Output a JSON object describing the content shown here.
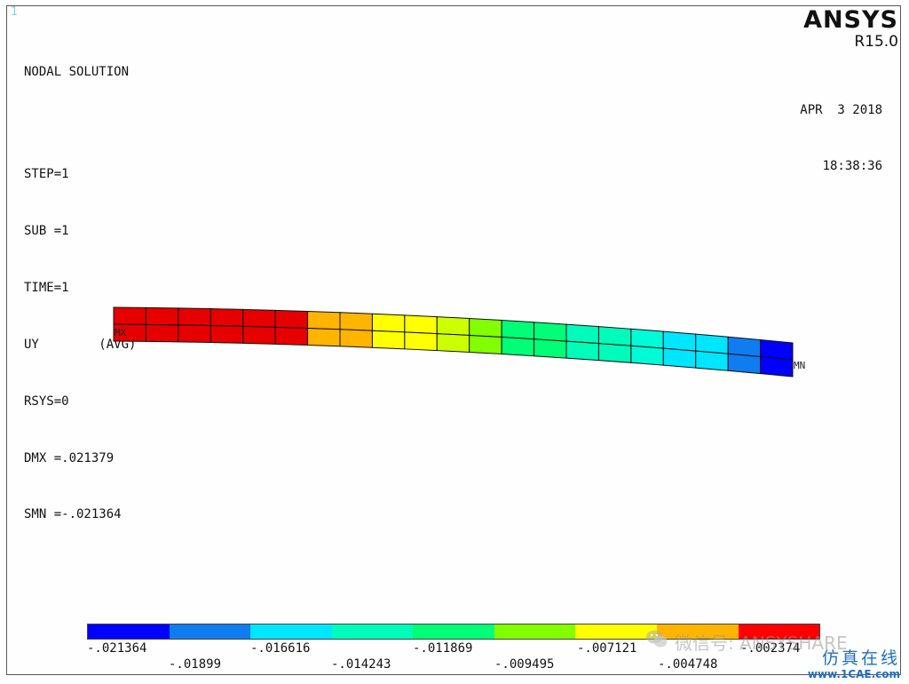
{
  "window_number": "1",
  "info": {
    "title": "NODAL SOLUTION",
    "step": "STEP=1",
    "sub": "SUB =1",
    "time": "TIME=1",
    "item": "UY        (AVG)",
    "rsys": "RSYS=0",
    "dmx": "DMX =.021379",
    "smn": "SMN =-.021364"
  },
  "brand": {
    "name": "ANSYS",
    "version": "R15.0"
  },
  "timestamp": {
    "date": "APR  3 2018",
    "time": "18:38:36"
  },
  "markers": {
    "max": "MX",
    "min": "MN"
  },
  "legend": {
    "colors": [
      "#0000ff",
      "#0f7cf0",
      "#00e6ff",
      "#00fcba",
      "#00ff77",
      "#82ff00",
      "#ffff00",
      "#ffb400",
      "#ff0000"
    ],
    "top_labels": [
      "-.021364",
      "-.016616",
      "-.011869",
      "-.007121",
      "-.002374"
    ],
    "bottom_labels": [
      "-.01899",
      "-.014243",
      "-.009495",
      "-.004748"
    ]
  },
  "contour_colors": [
    "#e60000",
    "#e60000",
    "#e60000",
    "#e60000",
    "#e60000",
    "#e60000",
    "#ffb400",
    "#ffb400",
    "#ffff00",
    "#ffff00",
    "#ccff00",
    "#82ff00",
    "#00ff77",
    "#00ff77",
    "#00fcba",
    "#00fcba",
    "#00fcd6",
    "#00e6ff",
    "#00e6ff",
    "#0f7cf0",
    "#0000ff"
  ],
  "watermark": {
    "text": "微信号: ANSYSHARE"
  },
  "site": {
    "cn": "仿真在线",
    "url": "www.1CAE.com"
  }
}
